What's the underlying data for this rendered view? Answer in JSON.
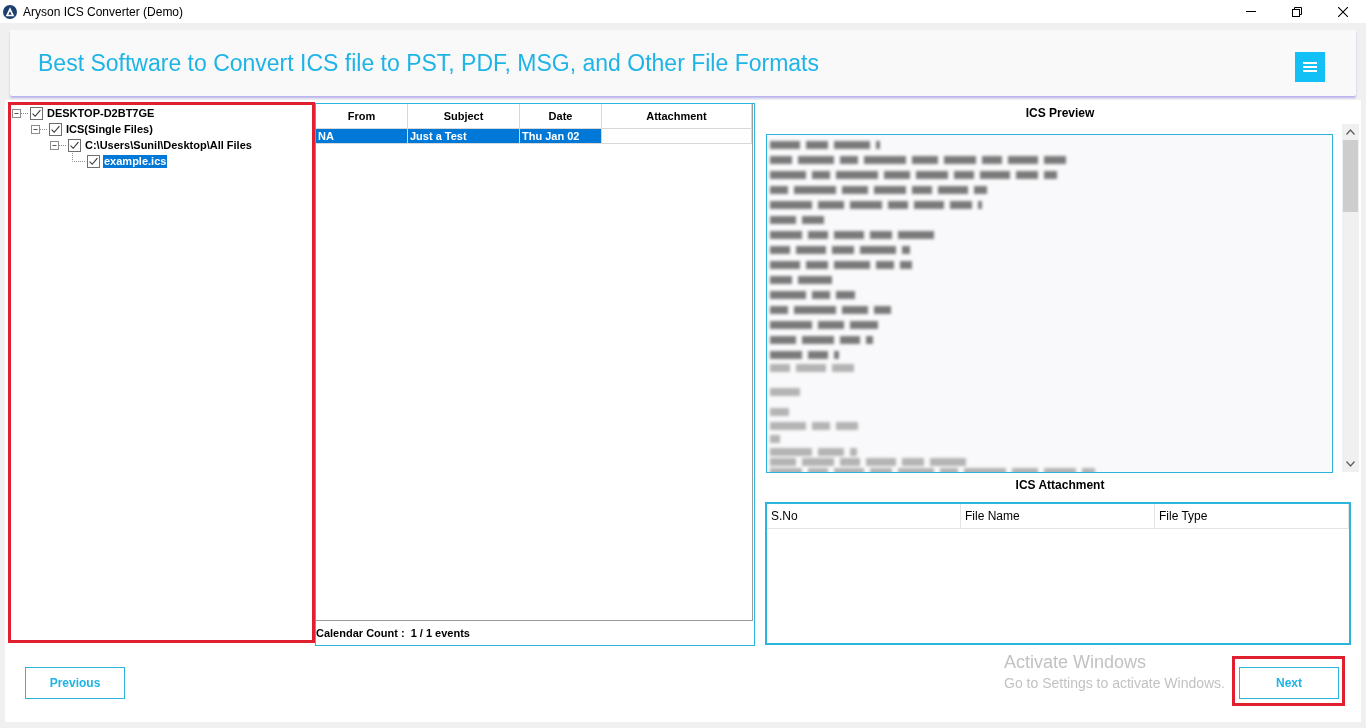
{
  "window": {
    "title": "Aryson ICS Converter (Demo)"
  },
  "header": {
    "title": "Best Software to Convert ICS file to PST, PDF, MSG, and Other File Formats"
  },
  "tree": {
    "highlighted": true,
    "items": [
      {
        "label": "DESKTOP-D2BT7GE",
        "checked": true,
        "expanded": true,
        "selected": false,
        "children": [
          {
            "label": "ICS(Single Files)",
            "checked": true,
            "expanded": true,
            "selected": false,
            "children": [
              {
                "label": "C:\\Users\\Sunil\\Desktop\\All Files",
                "checked": true,
                "expanded": true,
                "selected": false,
                "children": [
                  {
                    "label": "example.ics",
                    "checked": true,
                    "selected": true
                  }
                ]
              }
            ]
          }
        ]
      }
    ]
  },
  "calendar_table": {
    "columns": [
      "From",
      "Subject",
      "Date",
      "Attachment"
    ],
    "rows": [
      {
        "cells": [
          "NA",
          "Just a Test",
          "Thu Jan 02"
        ],
        "selected": true
      }
    ],
    "count_label": "Calendar Count :",
    "count_value": "1 / 1 events"
  },
  "preview": {
    "title": "ICS Preview"
  },
  "attachment_table": {
    "title": "ICS Attachment",
    "columns": [
      "S.No",
      "File Name",
      "File Type"
    ]
  },
  "buttons": [
    {
      "label": "Previous",
      "highlighted": false
    },
    {
      "label": "Next",
      "highlighted": true
    }
  ],
  "activation_notice": {
    "title": "Activate Windows",
    "text": "Go to Settings to activate Windows."
  }
}
